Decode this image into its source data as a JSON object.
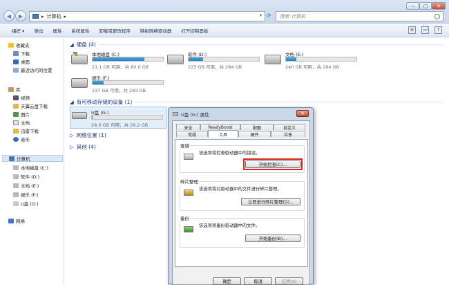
{
  "address": {
    "sep1": "▸",
    "location": "计算机",
    "sep2": "▸"
  },
  "search": {
    "placeholder": "搜索 计算机"
  },
  "window_controls": {
    "minimize": "–",
    "maximize": "□",
    "close": "✕"
  },
  "toolbar": {
    "items": [
      "组织 ▾",
      "弹出",
      "属性",
      "系统属性",
      "卸载或更改程序",
      "映射网络驱动器",
      "打开控制面板"
    ]
  },
  "nav": {
    "favorites": "收藏夹",
    "favorites_items": [
      "下载",
      "桌面",
      "最近访问的位置"
    ],
    "libraries": "库",
    "library_items": [
      "视频",
      "天翼云盘下载",
      "图片",
      "文档",
      "迅雷下载",
      "音乐"
    ],
    "computer": "计算机",
    "computer_items": [
      "本地磁盘 (C:)",
      "软件 (D:)",
      "文档 (E:)",
      "娱乐 (F:)",
      "U盘 (G:)"
    ],
    "network": "网络"
  },
  "groups": {
    "hdd": "硬盘 (4)",
    "removable": "有可移动存储的设备 (1)",
    "network": "网络位置 (1)",
    "other": "其他 (4)"
  },
  "drives": [
    {
      "name": "本地磁盘 (C:)",
      "size": "21.1 GB 可用，共 80.0 GB",
      "used": 0.74
    },
    {
      "name": "软件 (D:)",
      "size": "225 GB 可用，共 284 GB",
      "used": 0.21
    },
    {
      "name": "文档 (E:)",
      "size": "240 GB 可用，共 284 GB",
      "used": 0.15
    },
    {
      "name": "娱乐 (F:)",
      "size": "237 GB 可用，共 283 GB",
      "used": 0.16
    }
  ],
  "usb": {
    "name": "U盘 (G:)",
    "size": "28.0 GB 可用，共 28.2 GB",
    "used": 0.01
  },
  "dialog": {
    "title": "U盘 (G:) 属性",
    "close": "✕",
    "tabs_row1": [
      "安全",
      "ReadyBoost",
      "配额",
      "自定义"
    ],
    "tabs_row2": [
      "常规",
      "工具",
      "硬件",
      "共享"
    ],
    "check_title": "查错",
    "check_text": "该选项将检查驱动器中的错误。",
    "check_button": "开始检查(C)...",
    "defrag_title": "碎片整理",
    "defrag_text": "该选项将对驱动器中的文件进行碎片整理。",
    "defrag_button": "立即进行碎片整理(D)...",
    "backup_title": "备份",
    "backup_text": "该选项将备份驱动器中的文件。",
    "backup_button": "开始备份(B)...",
    "ok": "确定",
    "cancel": "取消",
    "apply": "应用(A)"
  }
}
